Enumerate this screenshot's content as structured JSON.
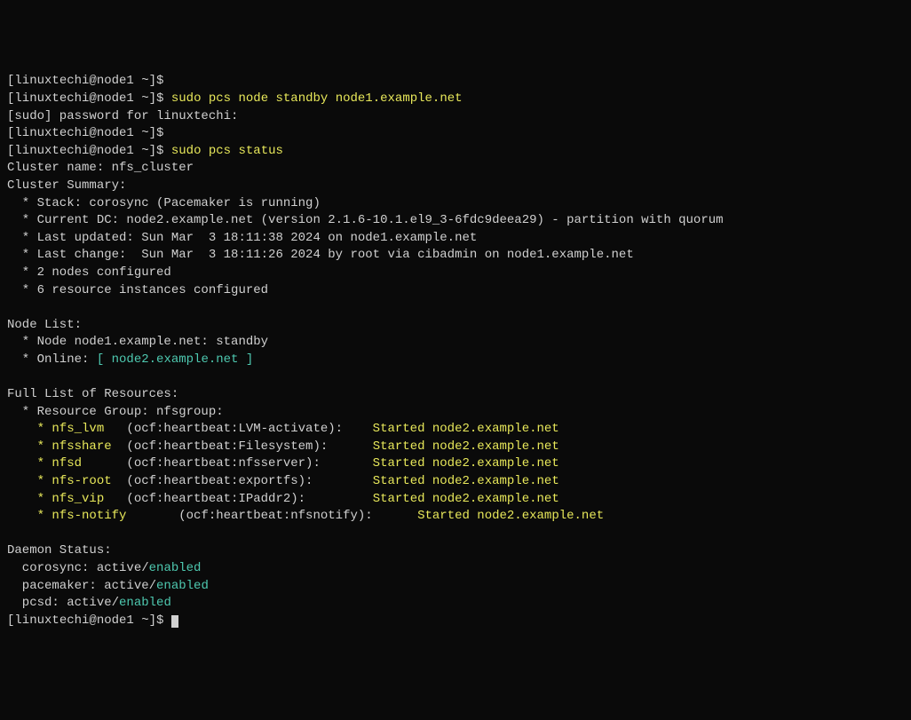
{
  "prompt": {
    "user": "linuxtechi",
    "host": "node1",
    "path": "~"
  },
  "lines": {
    "cmd1": "sudo pcs node standby node1.example.net",
    "sudo_prompt": "[sudo] password for linuxtechi:",
    "cmd2": "sudo pcs status",
    "cluster_name": "Cluster name: nfs_cluster",
    "cluster_summary": "Cluster Summary:",
    "stack": "  * Stack: corosync (Pacemaker is running)",
    "current_dc": "  * Current DC: node2.example.net (version 2.1.6-10.1.el9_3-6fdc9deea29) - partition with quorum",
    "last_updated": "  * Last updated: Sun Mar  3 18:11:38 2024 on node1.example.net",
    "last_change": "  * Last change:  Sun Mar  3 18:11:26 2024 by root via cibadmin on node1.example.net",
    "nodes_configured": "  * 2 nodes configured",
    "resources_configured": "  * 6 resource instances configured",
    "node_list_header": "Node List:",
    "node_standby": "  * Node node1.example.net: standby",
    "node_online_prefix": "  * Online: ",
    "node_online_value": "[ node2.example.net ]",
    "resources_header": "Full List of Resources:",
    "resource_group": "  * Resource Group: nfsgroup:",
    "res1_name": "    * nfs_lvm   ",
    "res1_type": "(ocf:heartbeat:LVM-activate):",
    "res1_pad": "    ",
    "res1_status": "Started node2.example.net",
    "res2_name": "    * nfsshare  ",
    "res2_type": "(ocf:heartbeat:Filesystem):",
    "res2_pad": "      ",
    "res2_status": "Started node2.example.net",
    "res3_name": "    * nfsd      ",
    "res3_type": "(ocf:heartbeat:nfsserver):",
    "res3_pad": "       ",
    "res3_status": "Started node2.example.net",
    "res4_name": "    * nfs-root  ",
    "res4_type": "(ocf:heartbeat:exportfs):",
    "res4_pad": "        ",
    "res4_status": "Started node2.example.net",
    "res5_name": "    * nfs_vip   ",
    "res5_type": "(ocf:heartbeat:IPaddr2):",
    "res5_pad": "         ",
    "res5_status": "Started node2.example.net",
    "res6_name": "    * nfs-notify       ",
    "res6_type": "(ocf:heartbeat:nfsnotify):",
    "res6_pad": "      ",
    "res6_status": "Started node2.example.net",
    "daemon_header": "Daemon Status:",
    "d1_prefix": "  corosync: active/",
    "d1_status": "enabled",
    "d2_prefix": "  pacemaker: active/",
    "d2_status": "enabled",
    "d3_prefix": "  pcsd: active/",
    "d3_status": "enabled"
  }
}
